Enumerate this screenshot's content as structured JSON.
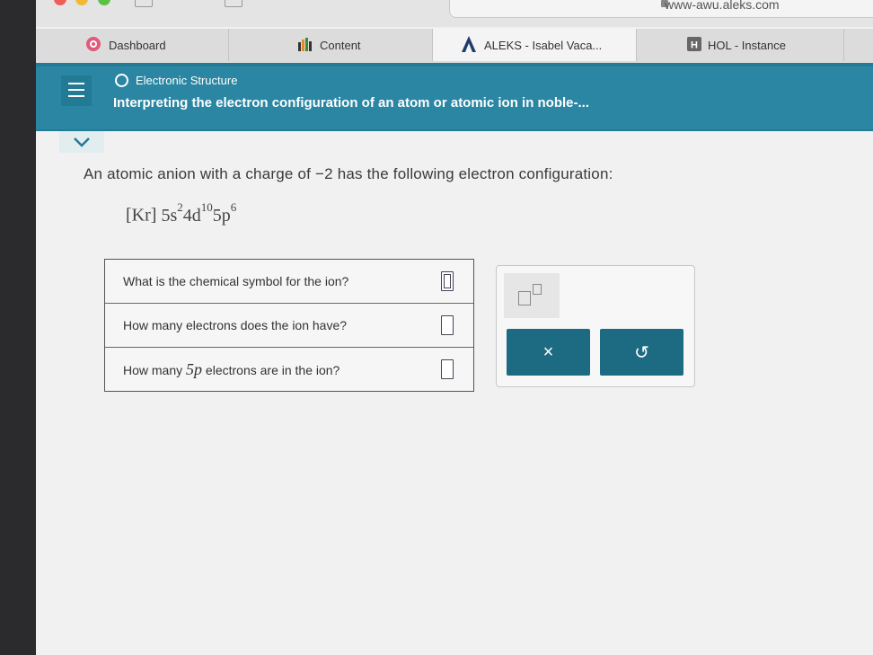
{
  "browser": {
    "url": "www-awu.aleks.com",
    "tabs": [
      {
        "label": "Dashboard",
        "icon": "dashboard-icon",
        "active": false
      },
      {
        "label": "Content",
        "icon": "content-chart-icon",
        "active": false
      },
      {
        "label": "ALEKS - Isabel Vaca...",
        "icon": "aleks-a-icon",
        "active": true
      },
      {
        "label": "HOL - Instance",
        "icon": "hol-h-icon",
        "active": false
      }
    ]
  },
  "header": {
    "topic": "Electronic Structure",
    "title": "Interpreting the electron configuration of an atom or atomic ion in noble-..."
  },
  "question": {
    "prefix": "An atomic anion with a charge of ",
    "charge": "−2",
    "suffix": " has the following electron configuration:",
    "config": {
      "core": "[Kr]",
      "terms": [
        {
          "orbital": "5s",
          "exponent": "2"
        },
        {
          "orbital": "4d",
          "exponent": "10"
        },
        {
          "orbital": "5p",
          "exponent": "6"
        }
      ]
    }
  },
  "table": {
    "rows": [
      {
        "label": "What is the chemical symbol for the ion?"
      },
      {
        "label_prefix": "How many electrons does the ion have?"
      },
      {
        "label_prefix": "How many ",
        "label_italic": "5p",
        "label_suffix": " electrons are in the ion?"
      }
    ]
  },
  "tools": {
    "clear_symbol": "×",
    "undo_symbol": "↺"
  },
  "colors": {
    "header": "#2a86a2",
    "button": "#1d6b83"
  }
}
